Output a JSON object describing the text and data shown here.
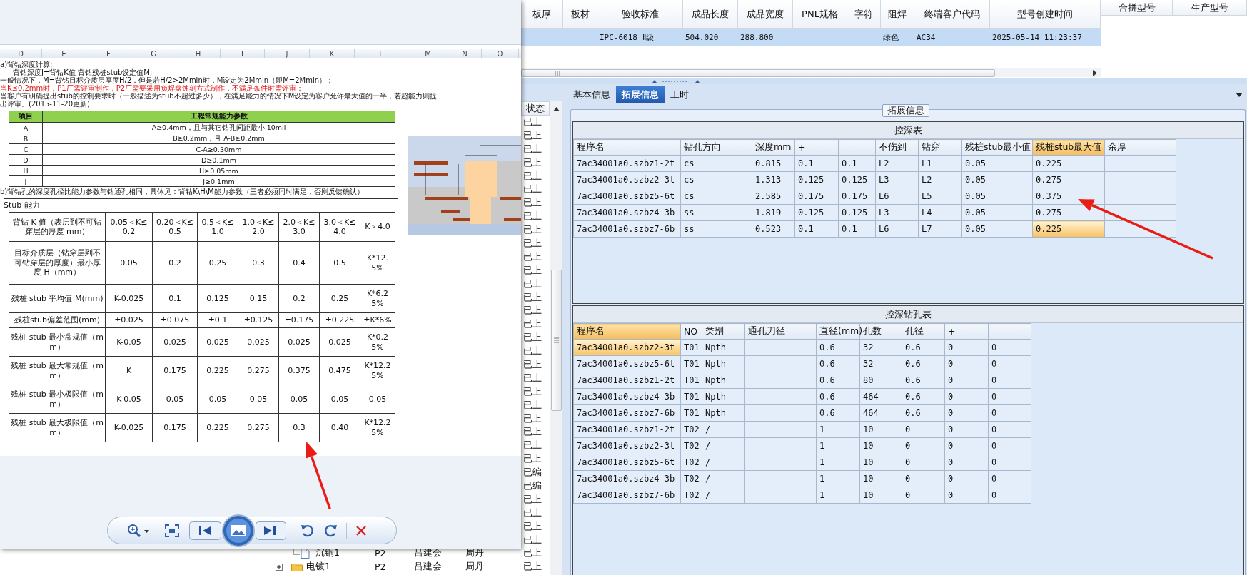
{
  "grid": {
    "columns": [
      "板厚",
      "板材",
      "验收标准",
      "成品长度",
      "成品宽度",
      "PNL规格",
      "字符",
      "阻焊",
      "终端客户代码",
      "型号创建时间"
    ],
    "rows": [
      {
        "selected": true,
        "cells": [
          null,
          null,
          "IPC-6018 Ⅱ级",
          "504.020",
          "288.800",
          null,
          null,
          "绿色",
          "AC34",
          "2025-05-14 11:23:37"
        ]
      }
    ]
  },
  "side_grid": {
    "columns": [
      "合拼型号",
      "生产型号"
    ]
  },
  "task_list": {
    "columns": [
      "状态"
    ],
    "rows": [
      {
        "status": "已上"
      },
      {
        "status": "已上"
      },
      {
        "status": "已上"
      },
      {
        "status": "已上"
      },
      {
        "status": "已上"
      },
      {
        "status": "已上"
      },
      {
        "status": "已上"
      },
      {
        "status": "已上"
      },
      {
        "status": "已上"
      },
      {
        "status": "已上"
      },
      {
        "status": "已上"
      },
      {
        "status": "已上"
      },
      {
        "status": "已上"
      },
      {
        "status": "已上"
      },
      {
        "status": "已上"
      },
      {
        "status": "已上"
      },
      {
        "status": "已上"
      },
      {
        "status": "已上"
      },
      {
        "status": "已上"
      },
      {
        "status": "已上"
      },
      {
        "status": "已上"
      },
      {
        "status": "已上"
      },
      {
        "status": "已上"
      },
      {
        "status": "已上"
      },
      {
        "status": "已上"
      },
      {
        "status": "已上"
      },
      {
        "status": "已编"
      },
      {
        "status": "已编"
      },
      {
        "status": "已上"
      },
      {
        "status": "已上"
      },
      {
        "status": "已上"
      },
      {
        "status": "已上"
      },
      {
        "status": "已上",
        "kind": "document",
        "name": "沉铜1",
        "layer": "P2",
        "person_1": "吕建会",
        "person_2": "周丹"
      },
      {
        "status": "已上",
        "kind": "folder",
        "name": "电镀1",
        "layer": "P2",
        "person_1": "吕建会",
        "person_2": "周丹"
      }
    ]
  },
  "tabs": [
    {
      "label": "基本信息",
      "selected": false
    },
    {
      "label": "拓展信息",
      "selected": true
    },
    {
      "label": "工时",
      "selected": false
    }
  ],
  "group_title": "拓展信息",
  "depth_table": {
    "title": "控深表",
    "columns": [
      {
        "label": "程序名",
        "highlighted": false
      },
      {
        "label": "钻孔方向",
        "highlighted": false
      },
      {
        "label": "深度mm",
        "highlighted": false
      },
      {
        "label": "+",
        "highlighted": false
      },
      {
        "label": "-",
        "highlighted": false
      },
      {
        "label": "不伤到",
        "highlighted": false
      },
      {
        "label": "钻穿",
        "highlighted": false
      },
      {
        "label": "残桩stub最小值",
        "highlighted": false
      },
      {
        "label": "残桩stub最大值",
        "highlighted": true
      },
      {
        "label": "余厚",
        "highlighted": false
      }
    ],
    "rows": [
      {
        "selected": false,
        "cells": [
          "7ac34001a0.szbz1-2t",
          "cs",
          "0.815",
          "0.1",
          "0.1",
          "L2",
          "L1",
          "0.05",
          "0.225",
          null
        ]
      },
      {
        "selected": false,
        "cells": [
          "7ac34001a0.szbz2-3t",
          "cs",
          "1.313",
          "0.125",
          "0.125",
          "L3",
          "L2",
          "0.05",
          "0.275",
          null
        ]
      },
      {
        "selected": false,
        "cells": [
          "7ac34001a0.szbz5-6t",
          "cs",
          "2.585",
          "0.175",
          "0.175",
          "L6",
          "L5",
          "0.05",
          "0.375",
          null
        ]
      },
      {
        "selected": false,
        "cells": [
          "7ac34001a0.szbz4-3b",
          "ss",
          "1.819",
          "0.125",
          "0.125",
          "L3",
          "L4",
          "0.05",
          "0.275",
          null
        ]
      },
      {
        "selected": true,
        "cells": [
          "7ac34001a0.szbz7-6b",
          "ss",
          "0.523",
          "0.1",
          "0.1",
          "L6",
          "L7",
          "0.05",
          "0.225",
          null
        ]
      }
    ]
  },
  "hole_table": {
    "title": "控深钻孔表",
    "columns": [
      {
        "label": "程序名",
        "highlighted": true
      },
      {
        "label": "NO",
        "highlighted": false
      },
      {
        "label": "类别",
        "highlighted": false
      },
      {
        "label": "通孔刀径",
        "highlighted": false
      },
      {
        "label": "直径(mm)",
        "highlighted": false
      },
      {
        "label": "孔数",
        "highlighted": false
      },
      {
        "label": "孔径",
        "highlighted": false
      },
      {
        "label": "+",
        "highlighted": false
      },
      {
        "label": "-",
        "highlighted": false
      }
    ],
    "rows": [
      {
        "selected": true,
        "cells": [
          "7ac34001a0.szbz2-3t",
          "T01",
          "Npth",
          null,
          "0.6",
          "32",
          "0.6",
          "0",
          "0"
        ]
      },
      {
        "selected": false,
        "cells": [
          "7ac34001a0.szbz5-6t",
          "T01",
          "Npth",
          null,
          "0.6",
          "32",
          "0.6",
          "0",
          "0"
        ]
      },
      {
        "selected": false,
        "cells": [
          "7ac34001a0.szbz1-2t",
          "T01",
          "Npth",
          null,
          "0.6",
          "80",
          "0.6",
          "0",
          "0"
        ]
      },
      {
        "selected": false,
        "cells": [
          "7ac34001a0.szbz4-3b",
          "T01",
          "Npth",
          null,
          "0.6",
          "464",
          "0.6",
          "0",
          "0"
        ]
      },
      {
        "selected": false,
        "cells": [
          "7ac34001a0.szbz7-6b",
          "T01",
          "Npth",
          null,
          "0.6",
          "464",
          "0.6",
          "0",
          "0"
        ]
      },
      {
        "selected": false,
        "cells": [
          "7ac34001a0.szbz1-2t",
          "T02",
          "/",
          null,
          "1",
          "10",
          "0",
          "0",
          "0"
        ]
      },
      {
        "selected": false,
        "cells": [
          "7ac34001a0.szbz2-3t",
          "T02",
          "/",
          null,
          "1",
          "10",
          "0",
          "0",
          "0"
        ]
      },
      {
        "selected": false,
        "cells": [
          "7ac34001a0.szbz5-6t",
          "T02",
          "/",
          null,
          "1",
          "10",
          "0",
          "0",
          "0"
        ]
      },
      {
        "selected": false,
        "cells": [
          "7ac34001a0.szbz4-3b",
          "T02",
          "/",
          null,
          "1",
          "10",
          "0",
          "0",
          "0"
        ]
      },
      {
        "selected": false,
        "cells": [
          "7ac34001a0.szbz7-6b",
          "T02",
          "/",
          null,
          "1",
          "10",
          "0",
          "0",
          "0"
        ]
      }
    ]
  },
  "viewer": {
    "sheet_columns": [
      "D",
      "E",
      "F",
      "G",
      "H",
      "I",
      "J",
      "K",
      "L",
      "M",
      "N",
      "O"
    ],
    "notes": [
      {
        "kind": "plain",
        "text": "a)背钻深度计算:"
      },
      {
        "kind": "indented",
        "text": "背钻深度J=背钻K值-背钻残桩stub设定值M;"
      },
      {
        "kind": "plain",
        "text": "一般情况下，M=背钻目标介质层厚度H/2，但是若H/2>2Mmin时，M设定为2Mmin（即M=2Mmin）；"
      },
      {
        "kind": "warning",
        "text": "当K≤0.2mm时，P1厂需评审制作，P2厂需要采用负焊盘蚀刻方式制作，不满足条件时需评审；"
      },
      {
        "kind": "plain",
        "text": "当客户有明确提出stub的控制要求时（一般描述为stub不超过多少），在满足能力的情况下M设定为客户允许最大值的一半，若超能力则提"
      },
      {
        "kind": "plain",
        "text": "出评审。(2015-11-20更新)"
      }
    ],
    "params_table": {
      "columns": [
        "项目",
        "工程常规能力参数"
      ],
      "rows": [
        [
          "A",
          "A≥0.4mm，且与其它钻孔间距最小 10mil"
        ],
        [
          "B",
          "B≥0.2mm，且 A-B≥0.2mm"
        ],
        [
          "C",
          "C-A≥0.30mm"
        ],
        [
          "D",
          "D≥0.1mm"
        ],
        [
          "H",
          "H≥0.05mm"
        ],
        [
          "J",
          "J≥0.1mm"
        ]
      ]
    },
    "note_b": "b)背钻孔的深度孔径比能力参数与钻通孔相同，具体见：背钻K\\H\\M能力参数（三者必须同时满足，否则反馈确认）",
    "stub_title": "Stub 能力",
    "stub_table": [
      [
        "背钻 K 值（表层到不可钻穿层的厚度 mm）",
        "0.05＜K≤0.2",
        "0.20＜K≤0.5",
        "0.5＜K≤1.0",
        "1.0＜K≤2.0",
        "2.0＜K≤3.0",
        "3.0＜K≤4.0",
        "K＞4.0"
      ],
      [
        "目标介质层（钻穿层到不可钻穿层的厚度）最小厚度 H（mm）",
        "0.05",
        "0.2",
        "0.25",
        "0.3",
        "0.4",
        "0.5",
        "K*12.5%"
      ],
      [
        "残桩 stub 平均值 M(mm)",
        "K-0.025",
        "0.1",
        "0.125",
        "0.15",
        "0.2",
        "0.25",
        "K*6.25%"
      ],
      [
        "残桩stub偏差范围(mm)",
        "±0.025",
        "±0.075",
        "±0.1",
        "±0.125",
        "±0.175",
        "±0.225",
        "±K*6%"
      ],
      [
        "残桩 stub 最小常规值（mm）",
        "K-0.05",
        "0.025",
        "0.025",
        "0.025",
        "0.025",
        "0.025",
        "K*0.25%"
      ],
      [
        "残桩 stub 最大常规值（mm）",
        "K",
        "0.175",
        "0.225",
        "0.275",
        "0.375",
        "0.475",
        "K*12.25%"
      ],
      [
        "残桩 stub 最小极限值（mm）",
        "K-0.05",
        "0.05",
        "0.05",
        "0.05",
        "0.05",
        "0.05",
        "0.05"
      ],
      [
        "残桩 stub 最大极限值（mm）",
        "K-0.025",
        "0.175",
        "0.225",
        "0.275",
        "0.3",
        "0.40",
        "K*12.25%"
      ]
    ]
  }
}
